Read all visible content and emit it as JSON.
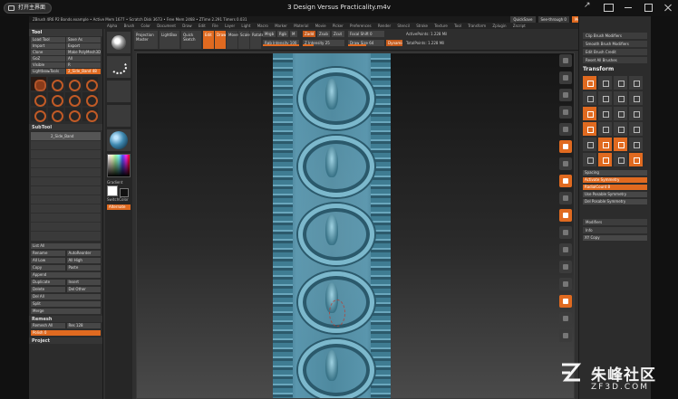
{
  "player": {
    "home_button": "打开主界面",
    "video_title": "3 Design Versus Practicality.m4v"
  },
  "app": {
    "titlebar_text": "ZBrush 4R6 P2   Bonds.example • Active Mem 1677 • Scratch Disk 3673 • Free Mem 2468 • ZTime 2.291 Timers 0.031",
    "quicksave": "QuickSave",
    "see_through": "See-through 0",
    "menus_label": "Menus",
    "default_script": "DefaultZScript",
    "menu_items": [
      "Alpha",
      "Brush",
      "Color",
      "Document",
      "Draw",
      "Edit",
      "File",
      "Layer",
      "Light",
      "Macro",
      "Marker",
      "Material",
      "Movie",
      "Picker",
      "Preferences",
      "Render",
      "Stencil",
      "Stroke",
      "Texture",
      "Tool",
      "Transform",
      "Zplugin",
      "Zscript"
    ]
  },
  "left_panel": {
    "title": "Tool",
    "buttons": [
      "Load Tool",
      "Save As",
      "Import",
      "Export",
      "Clone",
      "Make PolyMesh3D",
      "GoZ",
      "All",
      "Visible",
      "R",
      "Lightbox▸Tools",
      "2_Side_Band 48"
    ],
    "subtool_title": "SubTool",
    "subtool_rows": [
      "2_Side_Band",
      "",
      "",
      "",
      "",
      "",
      "",
      "",
      "",
      "",
      ""
    ],
    "list_all": "List All",
    "rename": "Rename",
    "auto_reorder": "AutoReorder",
    "all_low": "All Low",
    "all_high": "All High",
    "copy": "Copy",
    "paste": "Paste",
    "append": "Append",
    "duplicate": "Duplicate",
    "insert": "Insert",
    "delete": "Delete",
    "del_other": "Del Other",
    "del_all": "Del All",
    "split": "Split",
    "merge": "Merge",
    "remesh": "Remesh",
    "remesh_all": "Remesh All",
    "res": "Res 128",
    "polish": "Polish 0",
    "project": "Project"
  },
  "brush_column": {
    "gradient_label": "Gradient",
    "switch_color": "SwitchColor",
    "alternate": "Alternate"
  },
  "shelf": {
    "projection_master": "Projection Master",
    "lightbox": "LightBox",
    "quick_sketch": "Quick Sketch",
    "edit": "Edit",
    "draw": "Draw",
    "move": "Move",
    "scale": "Scale",
    "rotate": "Rotate",
    "mrgb": "Mrgb",
    "rgb": "Rgb",
    "m": "M",
    "rgb_intensity": "Rgb Intensity 100",
    "zadd": "Zadd",
    "zsub": "Zsub",
    "zcut": "Zcut",
    "z_intensity": "Z Intensity 25",
    "focal_shift": "Focal Shift 0",
    "draw_size": "Draw Size 64",
    "dynamic": "Dynamic",
    "active_points": "ActivePoints: 1.228 Mil",
    "total_points": "TotalPoints: 1.228 Mil"
  },
  "right_panel": {
    "clip_brush": "Clip Brush Modifiers",
    "smooth_brush": "Smooth Brush Modifiers",
    "edit_brush_credit": "Edit Brush Credit",
    "reset_all_brushes": "Reset All Brushes",
    "transform_title": "Transform",
    "activate_symmetry": "Activate Symmetry",
    "radial_count": "RadialCount 8",
    "use_posable": "Use Posable Symmetry",
    "del_posable": "Del Posable Symmetry",
    "modifiers": "Modifiers",
    "info": "Info",
    "xy_copy": "XY Copy",
    "spacing": "Spacing"
  },
  "watermark": {
    "cn": "朱峰社区",
    "en": "ZF3D.COM"
  },
  "colors": {
    "accent": "#e06a20",
    "model_blue": "#4e899f"
  }
}
